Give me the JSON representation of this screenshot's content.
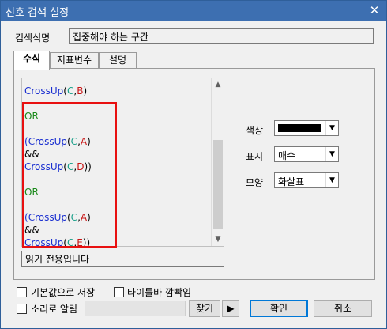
{
  "window": {
    "title": "신호 검색 설정",
    "close_glyph": "✕"
  },
  "search_name": {
    "label": "검색식명",
    "value": "집중해야 하는 구간"
  },
  "tabs": [
    {
      "label": "수식",
      "active": true
    },
    {
      "label": "지표변수",
      "active": false
    },
    {
      "label": "설명",
      "active": false
    }
  ],
  "formula_lines": [
    {
      "fn": "CrossUp",
      "a": "C",
      "b": "B",
      "prefix": "",
      "suffix": ")"
    },
    {
      "keyword": "OR"
    },
    {
      "fn": "CrossUp",
      "a": "C",
      "b": "A",
      "prefix": "(",
      "suffix": ")"
    },
    {
      "op": "&&"
    },
    {
      "fn": "CrossUp",
      "a": "C",
      "b": "D",
      "prefix": "",
      "suffix": "))"
    },
    {
      "keyword": "OR"
    },
    {
      "fn": "CrossUp",
      "a": "C",
      "b": "A",
      "prefix": "(",
      "suffix": ")"
    },
    {
      "op": "&&"
    },
    {
      "fn": "CrossUp",
      "a": "C",
      "b": "E",
      "prefix": "",
      "suffix": "))"
    }
  ],
  "readonly_text": "읽기 전용입니다",
  "color_row": {
    "label": "색상",
    "color": "#000000"
  },
  "display_row": {
    "label": "표시",
    "value": "매수"
  },
  "shape_row": {
    "label": "모양",
    "value": "화살표"
  },
  "options": {
    "save_default_label": "기본값으로 저장",
    "titlebar_blink_label": "타이틀바 깜빡임",
    "sound_alert_label": "소리로 알림"
  },
  "buttons": {
    "find": "찾기",
    "play": "▶",
    "ok": "확인",
    "cancel": "취소"
  },
  "colors": {
    "titlebar": "#3d6fb1",
    "highlight_box": "#e81010",
    "function_text": "#1a2fd0",
    "keyword_text": "#1a8a1a"
  }
}
